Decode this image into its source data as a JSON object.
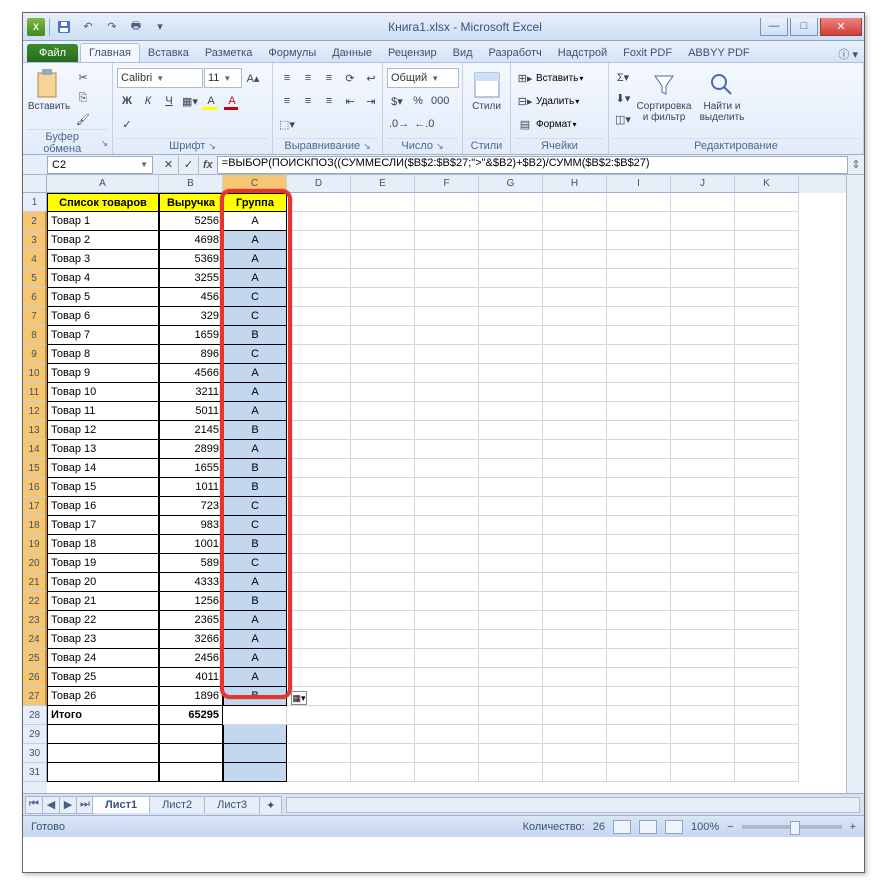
{
  "window": {
    "title": "Книга1.xlsx  -  Microsoft Excel"
  },
  "tabs": {
    "file": "Файл",
    "home": "Главная",
    "insert": "Вставка",
    "layout": "Разметка",
    "formulas": "Формулы",
    "data": "Данные",
    "review": "Рецензир",
    "view": "Вид",
    "developer": "Разработч",
    "addins": "Надстрой",
    "foxit": "Foxit PDF",
    "abbyy": "ABBYY PDF"
  },
  "ribbon": {
    "clipboard": {
      "paste": "Вставить",
      "label": "Буфер обмена"
    },
    "font": {
      "name": "Calibri",
      "size": "11",
      "label": "Шрифт"
    },
    "alignment": {
      "label": "Выравнивание"
    },
    "number": {
      "format": "Общий",
      "label": "Число"
    },
    "styles": {
      "label": "Стили",
      "btn": "Стили"
    },
    "cells": {
      "insert": "Вставить",
      "delete": "Удалить",
      "format": "Формат",
      "label": "Ячейки"
    },
    "editing": {
      "sort": "Сортировка и фильтр",
      "find": "Найти и выделить",
      "label": "Редактирование"
    }
  },
  "formula_bar": {
    "name_box": "C2",
    "formula": "=ВЫБОР(ПОИСКПОЗ((СУММЕСЛИ($B$2:$B$27;\">\"&$B2)+$B2)/СУММ($B$2:$B$27)"
  },
  "headers": {
    "col_a": "Список товаров",
    "col_b": "Выручка",
    "col_c": "Группа"
  },
  "columns": [
    "A",
    "B",
    "C",
    "D",
    "E",
    "F",
    "G",
    "H",
    "I",
    "J",
    "K"
  ],
  "rows": [
    {
      "n": "Товар 1",
      "v": "5256",
      "g": "A"
    },
    {
      "n": "Товар 2",
      "v": "4698",
      "g": "A"
    },
    {
      "n": "Товар 3",
      "v": "5369",
      "g": "A"
    },
    {
      "n": "Товар 4",
      "v": "3255",
      "g": "A"
    },
    {
      "n": "Товар 5",
      "v": "456",
      "g": "C"
    },
    {
      "n": "Товар 6",
      "v": "329",
      "g": "C"
    },
    {
      "n": "Товар 7",
      "v": "1659",
      "g": "B"
    },
    {
      "n": "Товар 8",
      "v": "896",
      "g": "C"
    },
    {
      "n": "Товар 9",
      "v": "4566",
      "g": "A"
    },
    {
      "n": "Товар 10",
      "v": "3211",
      "g": "A"
    },
    {
      "n": "Товар 11",
      "v": "5011",
      "g": "A"
    },
    {
      "n": "Товар 12",
      "v": "2145",
      "g": "B"
    },
    {
      "n": "Товар 13",
      "v": "2899",
      "g": "A"
    },
    {
      "n": "Товар 14",
      "v": "1655",
      "g": "B"
    },
    {
      "n": "Товар 15",
      "v": "1011",
      "g": "B"
    },
    {
      "n": "Товар 16",
      "v": "723",
      "g": "C"
    },
    {
      "n": "Товар 17",
      "v": "983",
      "g": "C"
    },
    {
      "n": "Товар 18",
      "v": "1001",
      "g": "B"
    },
    {
      "n": "Товар 19",
      "v": "589",
      "g": "C"
    },
    {
      "n": "Товар 20",
      "v": "4333",
      "g": "A"
    },
    {
      "n": "Товар 21",
      "v": "1256",
      "g": "B"
    },
    {
      "n": "Товар 22",
      "v": "2365",
      "g": "A"
    },
    {
      "n": "Товар 23",
      "v": "3266",
      "g": "A"
    },
    {
      "n": "Товар 24",
      "v": "2456",
      "g": "A"
    },
    {
      "n": "Товар 25",
      "v": "4011",
      "g": "A"
    },
    {
      "n": "Товар 26",
      "v": "1896",
      "g": "B"
    }
  ],
  "totals": {
    "label": "Итого",
    "value": "65295"
  },
  "sheets": {
    "s1": "Лист1",
    "s2": "Лист2",
    "s3": "Лист3"
  },
  "statusbar": {
    "ready": "Готово",
    "count_label": "Количество:",
    "count": "26",
    "zoom": "100%"
  }
}
